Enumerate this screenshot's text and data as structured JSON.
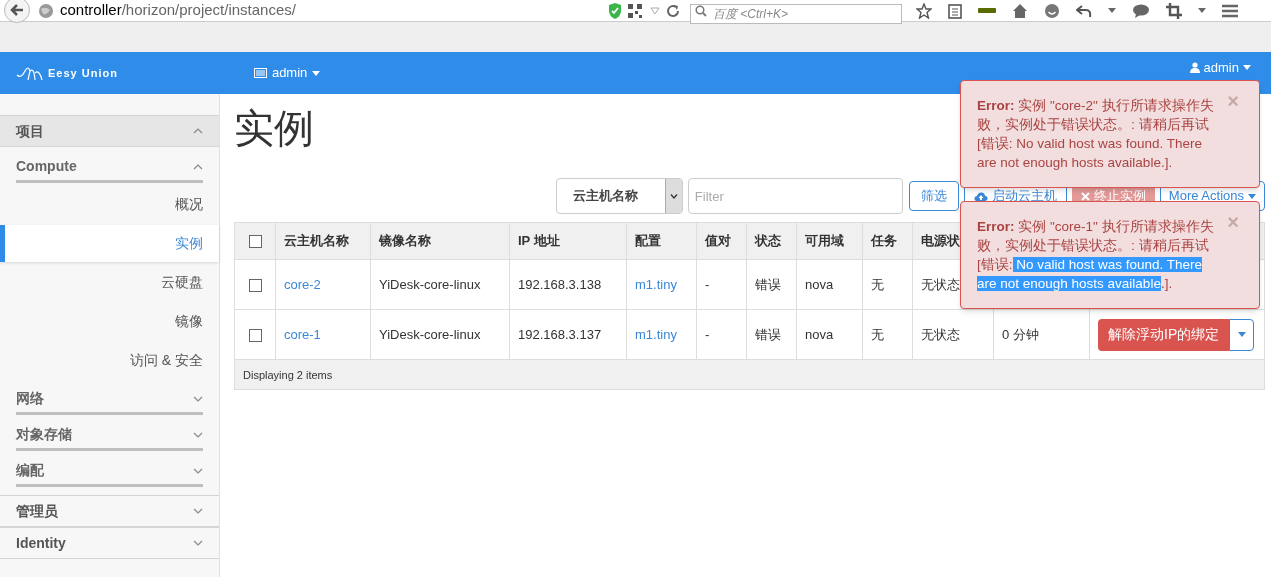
{
  "browser": {
    "url_host": "controller",
    "url_path": "/horizon/project/instances/",
    "search_placeholder": "百度 <Ctrl+K>"
  },
  "topbar": {
    "brand": "Eesy Union",
    "project": "admin",
    "user": "admin"
  },
  "sidebar": [
    {
      "label": "项目",
      "kind": "panel",
      "expanded": true,
      "children": [
        {
          "label": "Compute",
          "kind": "group",
          "expanded": true,
          "children": [
            {
              "label": "概况",
              "selected": false
            },
            {
              "label": "实例",
              "selected": true
            },
            {
              "label": "云硬盘",
              "selected": false
            },
            {
              "label": "镜像",
              "selected": false
            },
            {
              "label": "访问 & 安全",
              "selected": false
            }
          ]
        },
        {
          "label": "网络",
          "kind": "group",
          "expanded": false
        },
        {
          "label": "对象存储",
          "kind": "group",
          "expanded": false
        },
        {
          "label": "编配",
          "kind": "group",
          "expanded": false
        }
      ]
    },
    {
      "label": "管理员",
      "kind": "panel",
      "expanded": false
    },
    {
      "label": "Identity",
      "kind": "panel",
      "expanded": false
    }
  ],
  "page_title": "实例",
  "toolbar": {
    "filter_field": "云主机名称",
    "filter_placeholder": "Filter",
    "filter_button": "筛选",
    "launch_button": "启动云主机",
    "terminate_button": "终止实例",
    "more_button": "More Actions"
  },
  "table": {
    "select_all_checked": false,
    "columns": [
      "云主机名称",
      "镜像名称",
      "IP 地址",
      "配置",
      "值对",
      "状态",
      "可用域",
      "任务",
      "电源状"
    ],
    "rows": [
      {
        "checked": false,
        "cells": [
          "core-2",
          "YiDesk-core-linux",
          "192.168.3.138",
          "m1.tiny",
          "-",
          "错误",
          "nova",
          "无",
          "无状态"
        ]
      },
      {
        "checked": false,
        "cells": [
          "core-1",
          "YiDesk-core-linux",
          "192.168.3.137",
          "m1.tiny",
          "-",
          "错误",
          "nova",
          "无",
          "无状态"
        ],
        "time": "0 分钟",
        "action": "解除浮动IP的绑定"
      }
    ],
    "footer": "Displaying 2 items"
  },
  "alerts": [
    {
      "label": "Error:",
      "message": "实例 \"core-2\" 执行所请求操作失败，实例处于错误状态。: 请稍后再试 [错误: No valid host was found. There are not enough hosts available.].",
      "close": "×"
    },
    {
      "label": "Error:",
      "message": "实例 \"core-1\" 执行所请求操作失败，实例处于错误状态。: 请稍后再试 [错误:",
      "highlighted": " No valid host was found. There are not enough hosts available",
      "after": ".].",
      "close": "×"
    }
  ]
}
